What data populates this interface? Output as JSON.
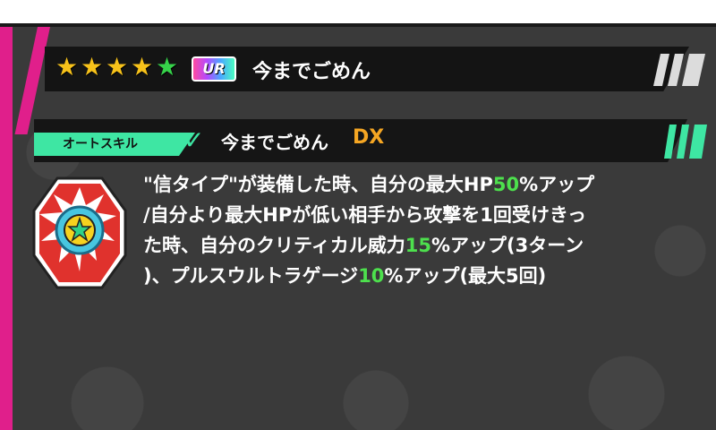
{
  "header": {
    "stars": [
      {
        "icon": "star-gold-icon"
      },
      {
        "icon": "star-gold-icon"
      },
      {
        "icon": "star-gold-icon"
      },
      {
        "icon": "star-gold-icon"
      },
      {
        "icon": "star-green-icon"
      }
    ],
    "rarity": "UR",
    "character_name": "今までごめん"
  },
  "skill": {
    "category": "オートスキル",
    "name": "今までごめん",
    "rank": "DX",
    "description_lines": [
      {
        "parts": [
          {
            "t": "\"信タイプ\"が装備した時、自分の最大HP"
          },
          {
            "t": "50",
            "n": true
          },
          {
            "t": "%アップ"
          }
        ]
      },
      {
        "parts": [
          {
            "t": "/自分より最大HPが低い相手から攻撃を1回受けきっ"
          }
        ]
      },
      {
        "parts": [
          {
            "t": "た時、自分のクリティカル威力"
          },
          {
            "t": "15",
            "n": true
          },
          {
            "t": "%アップ(3ターン"
          }
        ]
      },
      {
        "parts": [
          {
            "t": ")、プルスウルトラゲージ"
          },
          {
            "t": "10",
            "n": true
          },
          {
            "t": "%アップ(最大5回)"
          }
        ]
      }
    ]
  },
  "colors": {
    "star_gold": "#f7c21a",
    "star_green": "#36d24a",
    "accent_green": "#3ee6a3",
    "rank_orange": "#f5a623",
    "highlight_green": "#4de04d",
    "pink": "#e01f8b"
  }
}
